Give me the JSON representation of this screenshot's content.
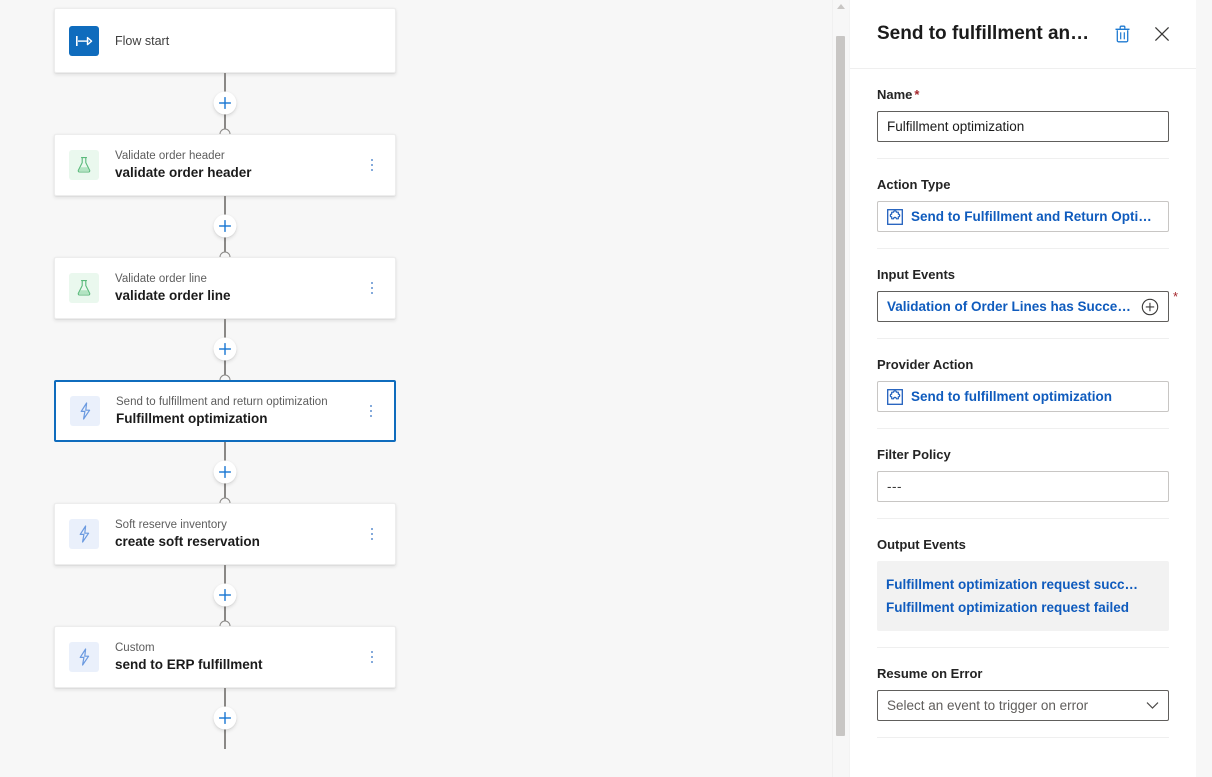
{
  "canvas": {
    "nodes": [
      {
        "kind": "start",
        "icon": "flow-start-icon",
        "subtitle": "",
        "title": "Flow start",
        "menu": false
      },
      {
        "kind": "flask",
        "icon": "flask-icon",
        "subtitle": "Validate order header",
        "title": "validate order header",
        "menu": true
      },
      {
        "kind": "flask",
        "icon": "flask-icon",
        "subtitle": "Validate order line",
        "title": "validate order line",
        "menu": true
      },
      {
        "kind": "bolt",
        "icon": "lightning-bolt-icon",
        "subtitle": "Send to fulfillment and return optimization",
        "title": "Fulfillment optimization",
        "menu": true,
        "selected": true
      },
      {
        "kind": "bolt",
        "icon": "lightning-bolt-icon",
        "subtitle": "Soft reserve inventory",
        "title": "create soft reservation",
        "menu": true
      },
      {
        "kind": "bolt",
        "icon": "lightning-bolt-icon",
        "subtitle": "Custom",
        "title": "send to ERP fulfillment",
        "menu": true
      }
    ],
    "add_step_label": "+"
  },
  "panel": {
    "title": "Send to fulfillment an…",
    "delete_icon": "trash-icon",
    "close_icon": "close-icon",
    "name": {
      "label": "Name",
      "required": "*",
      "value": "Fulfillment optimization"
    },
    "action_type": {
      "label": "Action Type",
      "icon": "puzzle-piece-icon",
      "value": "Send to Fulfillment and Return Optimiza…"
    },
    "input_events": {
      "label": "Input Events",
      "value": "Validation of Order Lines has Succeed…",
      "add_icon": "plus-circle-icon",
      "required": "*"
    },
    "provider_action": {
      "label": "Provider Action",
      "icon": "puzzle-piece-icon",
      "value": "Send to fulfillment optimization"
    },
    "filter_policy": {
      "label": "Filter Policy",
      "value": "---"
    },
    "output_events": {
      "label": "Output Events",
      "items": [
        "Fulfillment optimization request succ…",
        "Fulfillment optimization request failed"
      ]
    },
    "resume_on_error": {
      "label": "Resume on Error",
      "placeholder": "Select an event to trigger on error",
      "chevron_icon": "chevron-down-icon"
    }
  },
  "colors": {
    "accent_blue": "#0f6cbd",
    "link_blue": "#0f5bbd",
    "required_red": "#a4262c",
    "canvas_bg": "#f7f7f7",
    "node_green": "#eaf8ee",
    "node_lavender": "#eaf0fb"
  }
}
